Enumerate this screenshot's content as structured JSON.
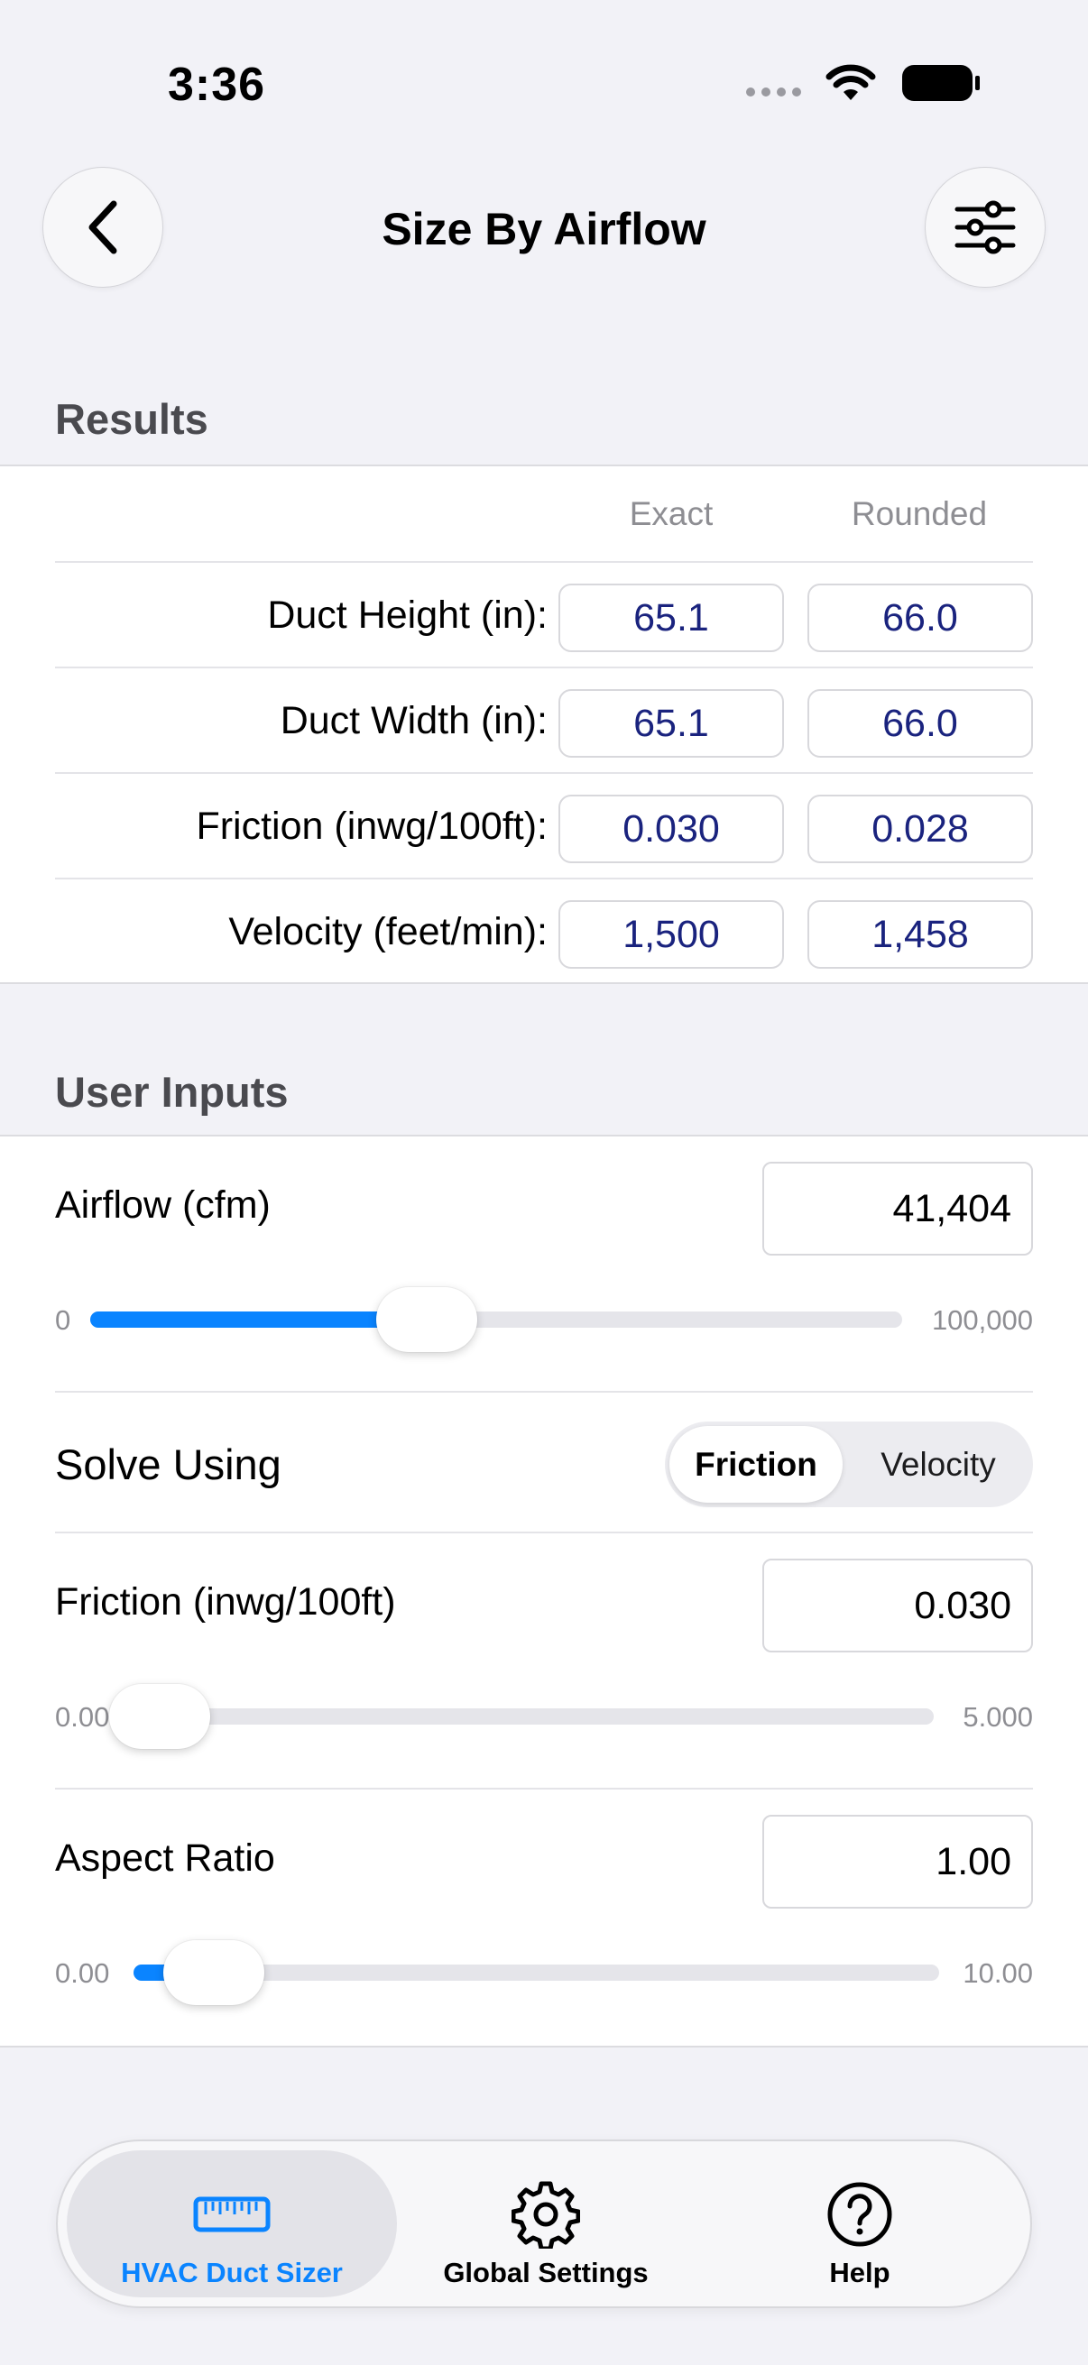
{
  "status": {
    "time": "3:36"
  },
  "nav": {
    "title": "Size By Airflow"
  },
  "results": {
    "section_title": "Results",
    "col_exact": "Exact",
    "col_rounded": "Rounded",
    "rows": [
      {
        "label": "Duct Height (in):",
        "exact": "65.1",
        "rounded": "66.0"
      },
      {
        "label": "Duct Width (in):",
        "exact": "65.1",
        "rounded": "66.0"
      },
      {
        "label": "Friction (inwg/100ft):",
        "exact": "0.030",
        "rounded": "0.028"
      },
      {
        "label": "Velocity (feet/min):",
        "exact": "1,500",
        "rounded": "1,458"
      }
    ]
  },
  "inputs": {
    "section_title": "User Inputs",
    "airflow": {
      "label": "Airflow (cfm)",
      "value": "41,404",
      "min": "0",
      "max": "100,000",
      "fraction": 0.414
    },
    "solve": {
      "label": "Solve Using",
      "options": [
        "Friction",
        "Velocity"
      ],
      "selected": "Friction"
    },
    "friction": {
      "label": "Friction (inwg/100ft)",
      "value": "0.030",
      "min": "0.000",
      "max": "5.000",
      "fraction": 0.006
    },
    "aspect": {
      "label": "Aspect Ratio",
      "value": "1.00",
      "min": "0.00",
      "max": "10.00",
      "fraction": 0.1
    }
  },
  "tabbar": {
    "tabs": [
      {
        "label": "HVAC Duct Sizer",
        "icon": "ruler-icon",
        "active": true
      },
      {
        "label": "Global Settings",
        "icon": "gear-icon",
        "active": false
      },
      {
        "label": "Help",
        "icon": "question-circle-icon",
        "active": false
      }
    ]
  },
  "colors": {
    "accent": "#0a84ff",
    "result_text": "#1a237e",
    "background": "#f2f2f7"
  }
}
